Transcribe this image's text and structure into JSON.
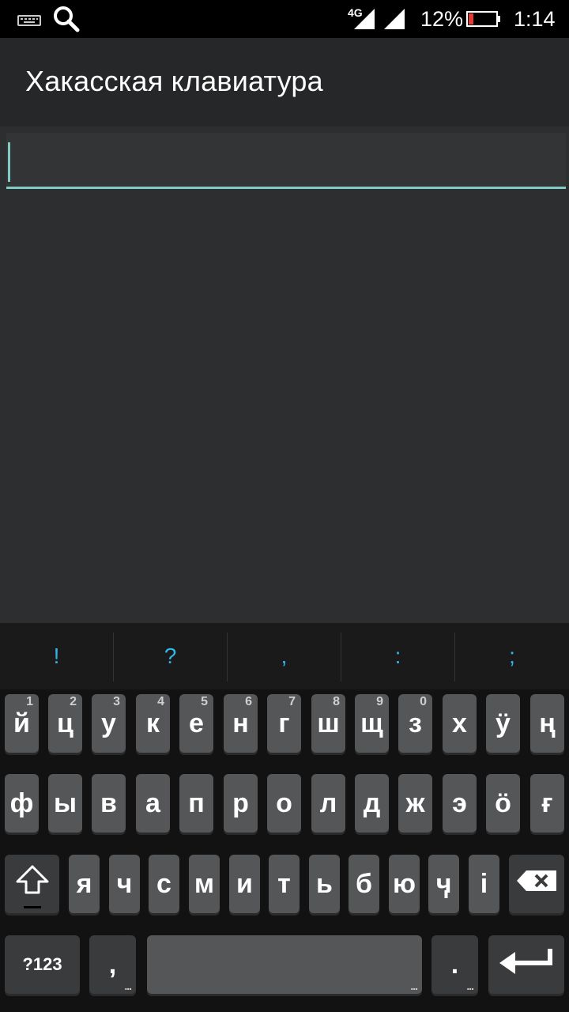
{
  "status_bar": {
    "network_type": "4G",
    "battery_percent": "12%",
    "time": "1:14",
    "icons": [
      "keyboard-icon",
      "search-icon",
      "signal-icon",
      "signal-icon",
      "battery-icon"
    ]
  },
  "app": {
    "title": "Хакасская клавиатура"
  },
  "input": {
    "value": "",
    "accent_color": "#80cbc4"
  },
  "keyboard": {
    "suggestions": [
      "!",
      "?",
      ",",
      ":",
      ";"
    ],
    "row1": [
      "й",
      "ц",
      "у",
      "к",
      "е",
      "н",
      "г",
      "ш",
      "щ",
      "з",
      "х",
      "ӱ",
      "ң"
    ],
    "row1_hints": [
      "1",
      "2",
      "3",
      "4",
      "5",
      "6",
      "7",
      "8",
      "9",
      "0"
    ],
    "row2": [
      "ф",
      "ы",
      "в",
      "а",
      "п",
      "р",
      "о",
      "л",
      "д",
      "ж",
      "э",
      "ӧ",
      "ғ"
    ],
    "row3": [
      "я",
      "ч",
      "с",
      "м",
      "и",
      "т",
      "ь",
      "б",
      "ю",
      "ӌ",
      "і"
    ],
    "symbols_label": "?123",
    "comma_label": ",",
    "period_label": ".",
    "shift_icon": "shift-icon",
    "backspace_icon": "backspace-icon",
    "enter_icon": "enter-icon",
    "more_indicator": "...",
    "suggestion_color": "#33b5e5"
  }
}
